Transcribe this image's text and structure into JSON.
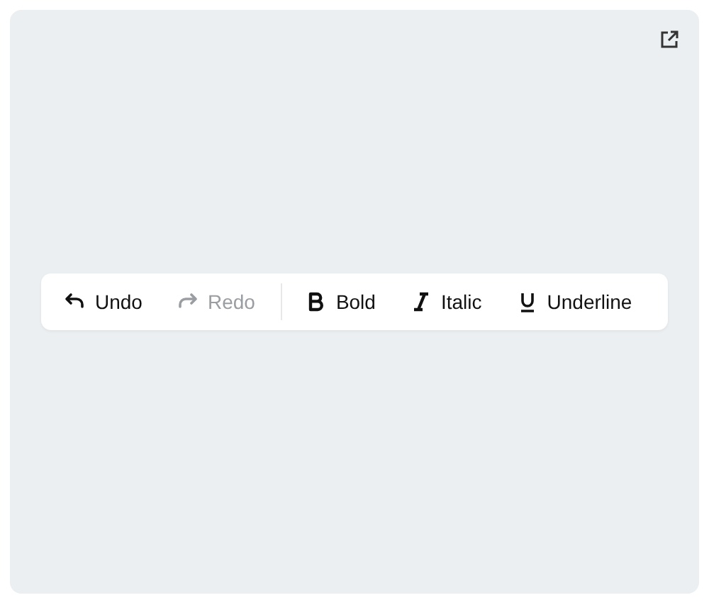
{
  "toolbar": {
    "groups": [
      {
        "buttons": [
          {
            "kind": "undo",
            "label": "Undo",
            "disabled": false
          },
          {
            "kind": "redo",
            "label": "Redo",
            "disabled": true
          }
        ]
      },
      {
        "buttons": [
          {
            "kind": "bold",
            "label": "Bold",
            "disabled": false
          },
          {
            "kind": "italic",
            "label": "Italic",
            "disabled": false
          },
          {
            "kind": "underline",
            "label": "Underline",
            "disabled": false
          }
        ]
      }
    ]
  }
}
